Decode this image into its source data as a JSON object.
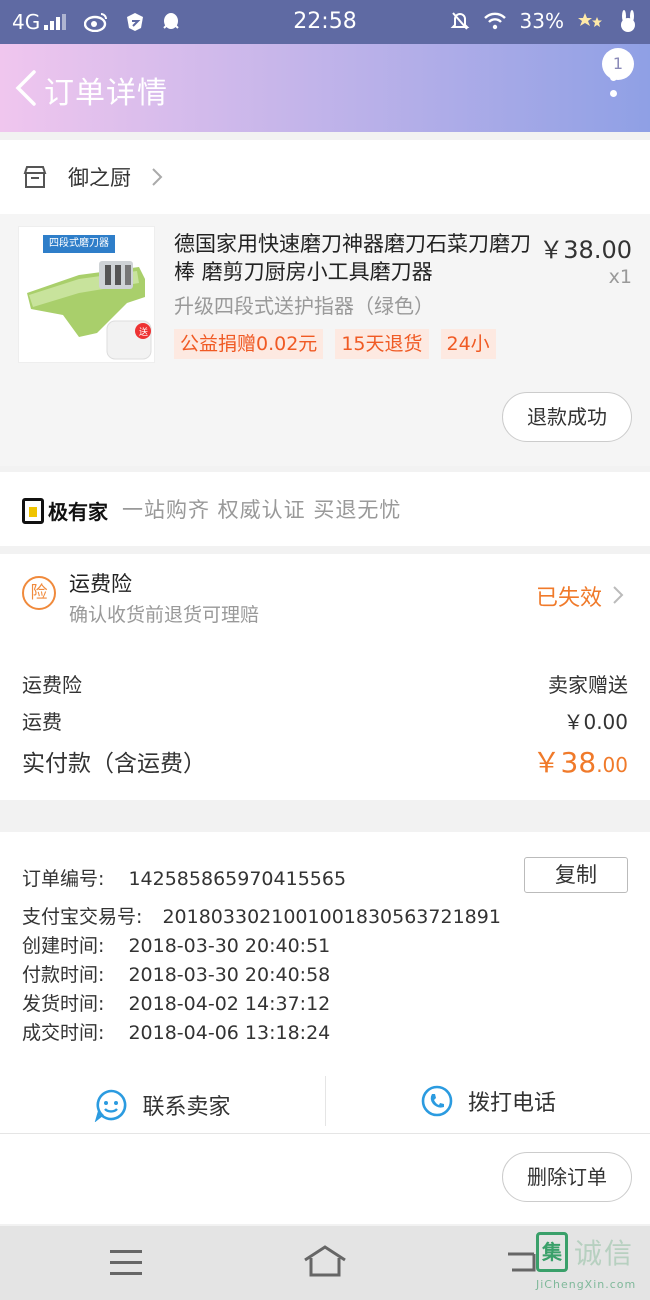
{
  "status_bar": {
    "network": "4G",
    "time": "22:58",
    "battery": "33%"
  },
  "navbar": {
    "title": "订单详情",
    "badge_count": "1"
  },
  "shop": {
    "name": "御之厨"
  },
  "product": {
    "image_banner": "四段式磨刀器",
    "title": "德国家用快速磨刀神器磨刀石菜刀磨刀棒 磨剪刀厨房小工具磨刀器",
    "price": "￥38.00",
    "quantity": "x1",
    "sku": "升级四段式送护指器（绿色）",
    "tags": [
      "公益捐赠0.02元",
      "15天退货",
      "24小"
    ],
    "refund_status_button": "退款成功"
  },
  "jiyoujia": {
    "logo_text": "极有家",
    "slogan": "一站购齐 权威认证 买退无忧"
  },
  "shipping_insurance": {
    "icon_char": "险",
    "title": "运费险",
    "subtitle": "确认收货前退货可理赔",
    "status": "已失效",
    "status_color": "#f07a2a"
  },
  "fees": {
    "insurance_label": "运费险",
    "insurance_value": "卖家赠送",
    "shipping_label": "运费",
    "shipping_value": "￥0.00",
    "total_label": "实付款（含运费）",
    "total_value_main": "￥38",
    "total_value_decimal": ".00"
  },
  "order_info": {
    "order_no_label": "订单编号:",
    "order_no": "142585865970415565",
    "copy_button": "复制",
    "alipay_label": "支付宝交易号:",
    "alipay_no": "2018033021001001830563721891",
    "created_label": "创建时间:",
    "created": "2018-03-30 20:40:51",
    "paid_label": "付款时间:",
    "paid": "2018-03-30 20:40:58",
    "shipped_label": "发货时间:",
    "shipped": "2018-04-02 14:37:12",
    "completed_label": "成交时间:",
    "completed": "2018-04-06 13:18:24"
  },
  "actions": {
    "contact_seller": "联系卖家",
    "call_phone": "拨打电话",
    "delete_order": "删除订单"
  },
  "watermark": {
    "mark": "集",
    "text": "诚信",
    "url": "JiChengXin.com"
  },
  "colors": {
    "accent_orange": "#f07a2a",
    "tag_bg": "#fde9e1",
    "tag_text": "#f05a24",
    "icon_blue": "#2b9be0"
  }
}
